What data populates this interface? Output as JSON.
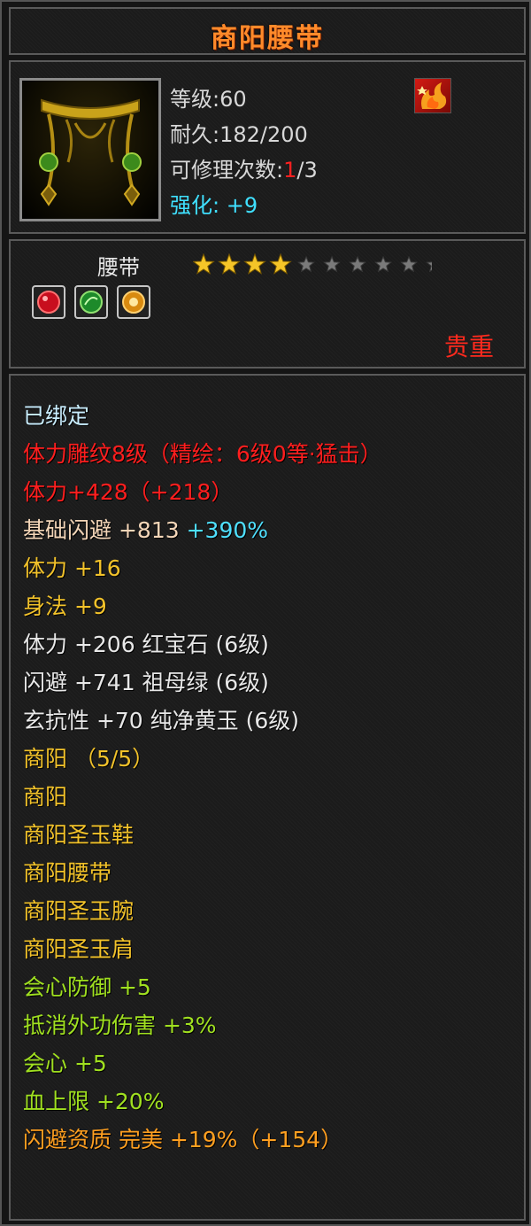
{
  "title": "商阳腰带",
  "stats": {
    "level": "等级:60",
    "durability": "耐久:182/200",
    "repair_prefix": "可修理次数:",
    "repair_current": "1",
    "repair_suffix": "/3",
    "strengthen": "强化: +9"
  },
  "item_type": "腰带",
  "stars": {
    "filled": 4,
    "total": 10
  },
  "gems": [
    "red-gem-icon",
    "green-gem-icon",
    "yellow-gem-icon"
  ],
  "rarity": "贵重",
  "colors": {
    "title": "#ff8a2a",
    "rarity": "#ff2a1e",
    "bound": "#c9eeff",
    "engraving": "#ff1e1e",
    "base": "#f4d6b8",
    "base_bonus": "#4fe0ff",
    "stat": "#f2c22a",
    "set": "#f2c22a",
    "set_bonus": "#a0e020",
    "aptitude": "#ff9f20"
  },
  "attributes": {
    "bound": "已绑定",
    "engraving": "体力雕纹8级（精绘：6级0等·猛击）",
    "engraving_value": "体力+428（+218）",
    "base_name": "基础闪避",
    "base_value": "+813",
    "base_bonus": "+390%",
    "stats": [
      "体力 +16",
      "身法 +9"
    ],
    "gem_lines": [
      "体力 +206 红宝石 (6级)",
      "闪避 +741 祖母绿 (6级)",
      "玄抗性 +70 纯净黄玉 (6级)"
    ],
    "set_title": "商阳 （5/5）",
    "set_items": [
      "商阳",
      "商阳圣玉鞋",
      "商阳腰带",
      "商阳圣玉腕",
      "商阳圣玉肩"
    ],
    "set_bonuses": [
      "会心防御 +5",
      "抵消外功伤害 +3%",
      "会心 +5",
      "血上限 +20%"
    ],
    "aptitude": "闪避资质  完美 +19%（+154）"
  }
}
